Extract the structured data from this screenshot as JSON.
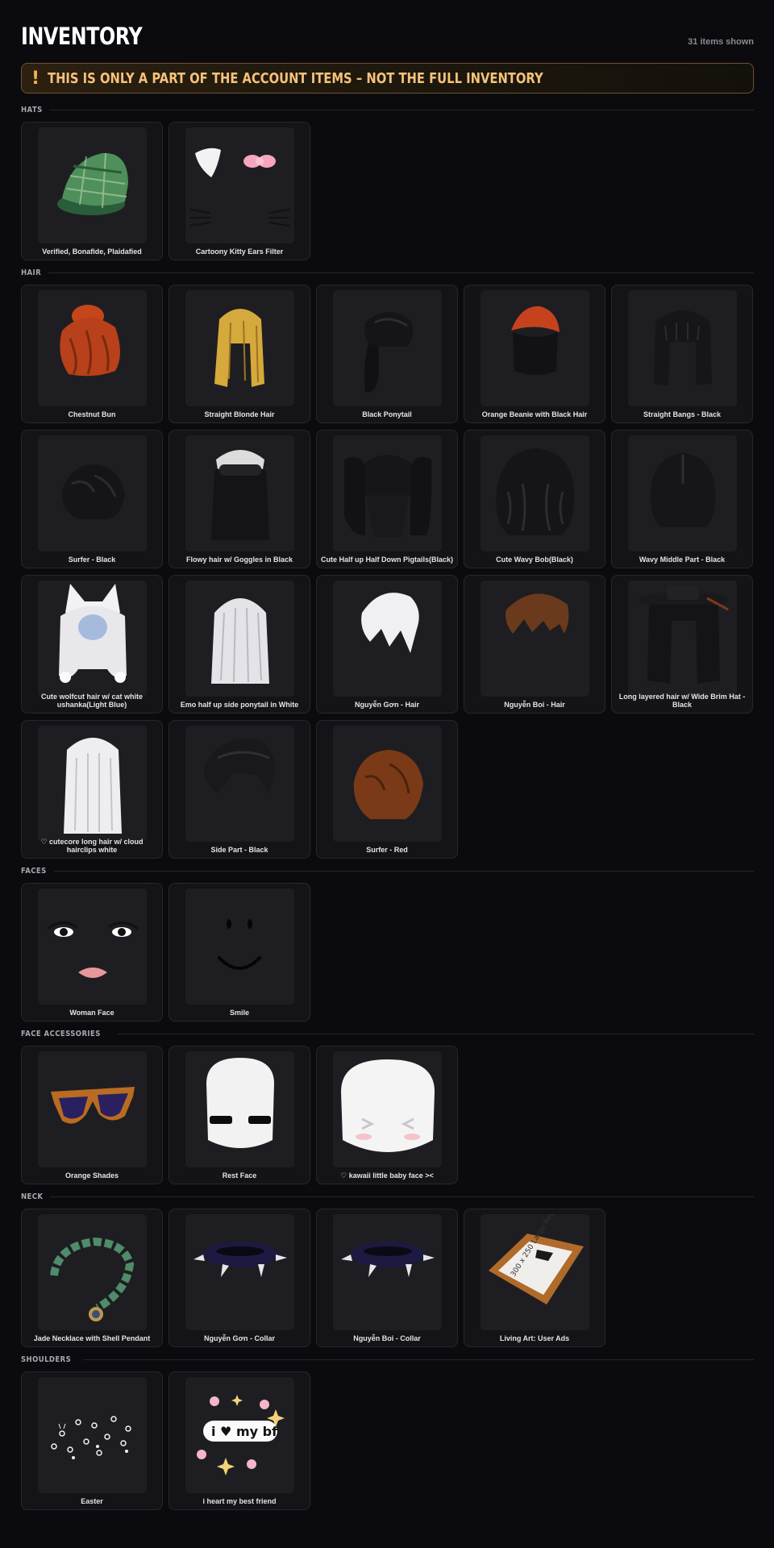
{
  "header": {
    "title": "INVENTORY",
    "count_text": "31 items shown"
  },
  "banner": {
    "icon": "!",
    "text": "THIS IS ONLY A PART OF THE ACCOUNT ITEMS – NOT THE FULL INVENTORY",
    "accent_color": "#f6c27a"
  },
  "sections": [
    {
      "label": "HATS",
      "items": [
        "Verified, Bonafide, Plaidafied",
        "Cartoony Kitty Ears Filter"
      ]
    },
    {
      "label": "HAIR",
      "items": [
        "Chestnut Bun",
        "Straight Blonde Hair",
        "Black Ponytail",
        "Orange Beanie with Black Hair",
        "Straight Bangs - Black",
        "Surfer - Black",
        "Flowy hair w/ Goggles in Black",
        "Cute Half up Half Down Pigtails(Black)",
        "Cute Wavy Bob(Black)",
        "Wavy Middle Part - Black",
        "Cute wolfcut hair w/ cat white ushanka(Light Blue)",
        "Emo half up side ponytail in White",
        "Nguyễn Gơn - Hair",
        "Nguyễn Boi - Hair",
        "Long layered hair w/ Wide Brim Hat - Black",
        "♡ cutecore long hair w/ cloud hairclips white",
        "Side Part - Black",
        "Surfer - Red"
      ]
    },
    {
      "label": "FACES",
      "items": [
        "Woman Face",
        "Smile"
      ]
    },
    {
      "label": "FACE ACCESSORIES",
      "items": [
        "Orange Shades",
        "Rest Face",
        "♡ kawaii little baby face ><"
      ]
    },
    {
      "label": "NECK",
      "items": [
        "Jade Necklace with Shell Pendant",
        "Nguyễn Gơn - Collar",
        "Nguyễn Boi - Collar",
        "Living Art: User Ads"
      ]
    },
    {
      "label": "SHOULDERS",
      "items": [
        "Easter",
        "i heart my best friend"
      ]
    }
  ],
  "icons": {
    "hats": [
      "plaid-cap-icon",
      "kitty-ears-icon"
    ],
    "hair": [
      "chestnut-bun-icon",
      "blonde-hair-icon",
      "ponytail-icon",
      "beanie-hair-icon",
      "bangs-hair-icon",
      "surfer-hair-icon",
      "goggles-hair-icon",
      "pigtails-hair-icon",
      "wavy-bob-icon",
      "middle-part-hair-icon",
      "wolfcut-ushanka-icon",
      "white-ponytail-icon",
      "white-short-hair-icon",
      "brown-short-hair-icon",
      "wide-brim-hat-hair-icon",
      "white-long-hair-icon",
      "side-part-hair-icon",
      "red-surfer-hair-icon"
    ],
    "faces": [
      "woman-face-icon",
      "smile-face-icon"
    ],
    "face_accessories": [
      "orange-shades-icon",
      "rest-face-icon",
      "baby-face-icon"
    ],
    "neck": [
      "jade-necklace-icon",
      "spiked-collar-icon",
      "spiked-collar-icon",
      "picture-frame-icon"
    ],
    "shoulders": [
      "easter-bunnies-icon",
      "heart-bf-icon"
    ]
  },
  "thumb_art": {
    "frame_text": "300 x 250 Large Rectangle",
    "bf_text": "i ♥ my bf"
  }
}
